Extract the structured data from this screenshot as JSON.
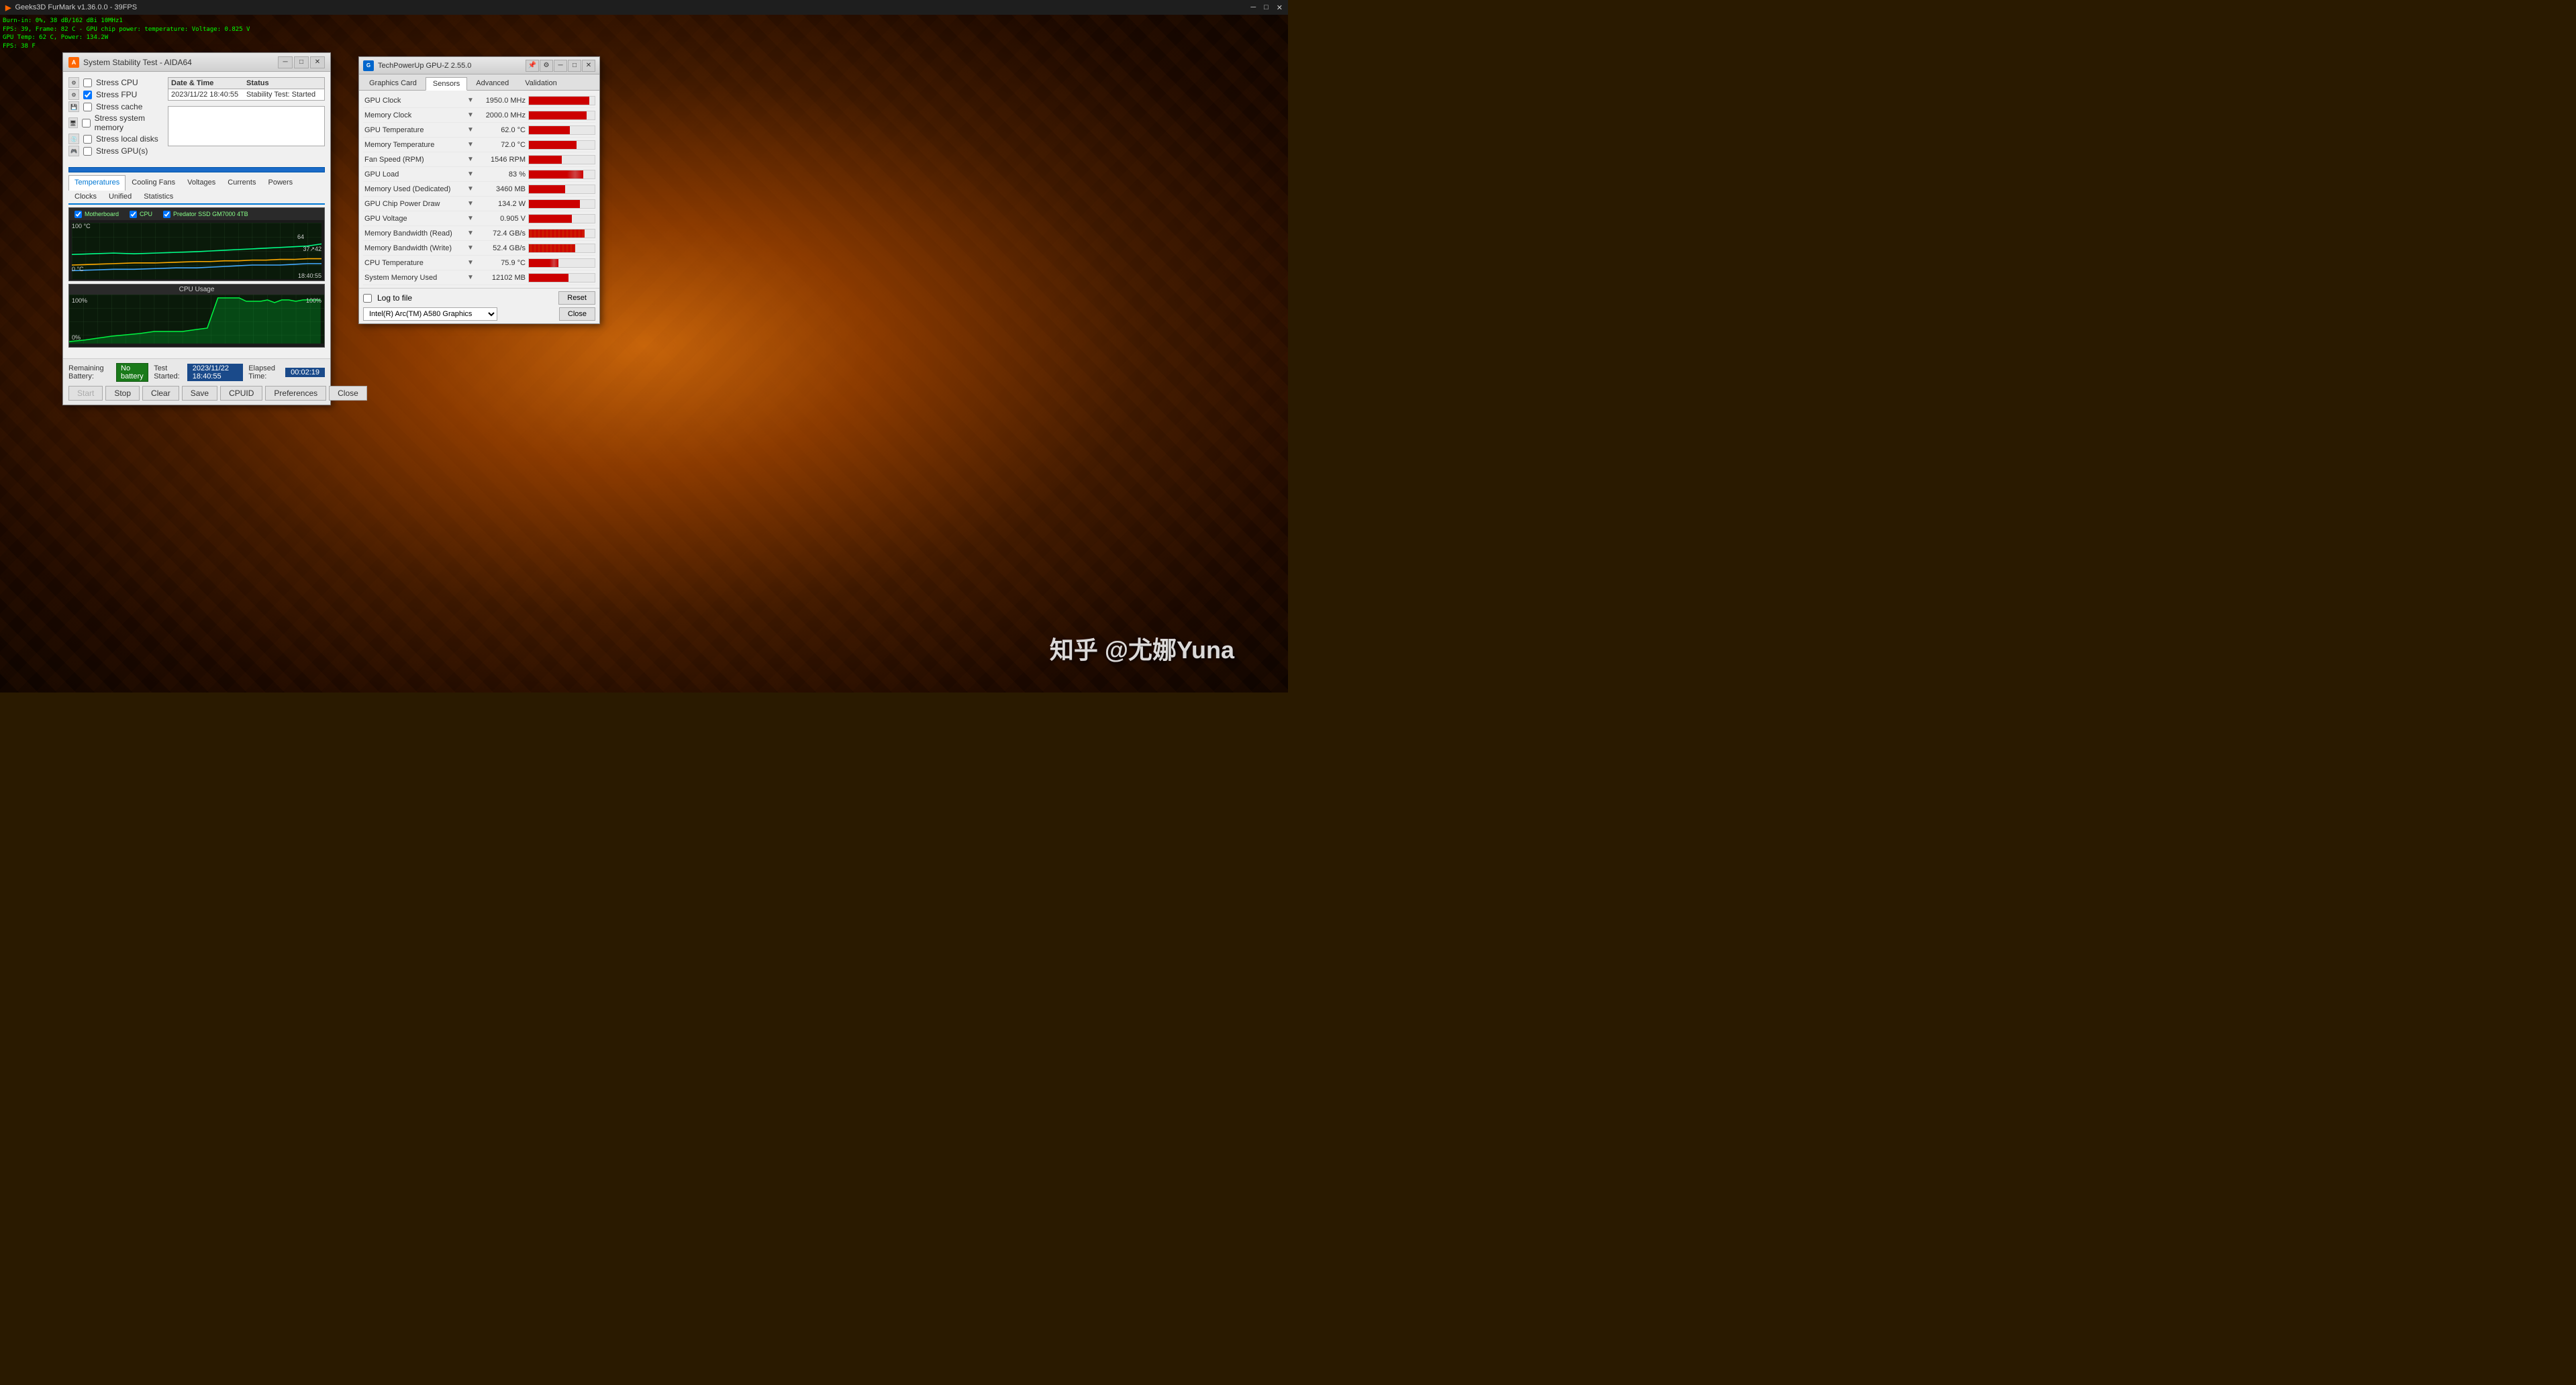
{
  "desktop": {
    "watermark": "知乎 @尤娜Yuna"
  },
  "furmark": {
    "titlebar": "Geeks3D FurMark v1.36.0.0 - 39FPS",
    "overlay_lines": [
      "Burn-in: 0%, 38 dB/162 dBi 10MHz1",
      "FPS: 39, Frame: 82 C - GPU chip power: temperature: Voltage: 0.825 V",
      "GPU Temp: 62 C, Power: 134.2W",
      "FPS: 38 F"
    ]
  },
  "aida": {
    "title": "System Stability Test - AIDA64",
    "stress_options": [
      {
        "label": "Stress CPU",
        "checked": false
      },
      {
        "label": "Stress FPU",
        "checked": true
      },
      {
        "label": "Stress cache",
        "checked": false
      },
      {
        "label": "Stress system memory",
        "checked": false
      },
      {
        "label": "Stress local disks",
        "checked": false
      },
      {
        "label": "Stress GPU(s)",
        "checked": false
      }
    ],
    "status_headers": [
      "Date & Time",
      "Status"
    ],
    "status_row": [
      "2023/11/22 18:40:55",
      "Stability Test: Started"
    ],
    "tabs": [
      "Temperatures",
      "Cooling Fans",
      "Voltages",
      "Currents",
      "Powers",
      "Clocks",
      "Unified",
      "Statistics"
    ],
    "active_tab": "Temperatures",
    "temp_graph": {
      "title": "",
      "legend": [
        "Motherboard",
        "CPU",
        "Predator SSD GM7000 4TB"
      ],
      "y_max": "100 °C",
      "y_min": "0 °C",
      "timestamp": "18:40:55",
      "value1": "64",
      "value2": "37",
      "value3": "42"
    },
    "cpu_graph": {
      "title": "CPU Usage",
      "y_max_left": "100%",
      "y_min_left": "0%",
      "y_max_right": "100%"
    },
    "battery_label": "Remaining Battery:",
    "battery_value": "No battery",
    "test_started_label": "Test Started:",
    "test_started_value": "2023/11/22 18:40:55",
    "elapsed_label": "Elapsed Time:",
    "elapsed_value": "00:02:19",
    "buttons": [
      "Start",
      "Stop",
      "Clear",
      "Save",
      "CPUID",
      "Preferences",
      "Close"
    ]
  },
  "gpuz": {
    "title": "TechPowerUp GPU-Z 2.55.0",
    "tabs": [
      "Graphics Card",
      "Sensors",
      "Advanced",
      "Validation"
    ],
    "active_tab": "Sensors",
    "sensors": [
      {
        "name": "GPU Clock",
        "value": "1950.0 MHz",
        "bar_pct": 92
      },
      {
        "name": "Memory Clock",
        "value": "2000.0 MHz",
        "bar_pct": 88
      },
      {
        "name": "GPU Temperature",
        "value": "62.0 °C",
        "bar_pct": 62
      },
      {
        "name": "Memory Temperature",
        "value": "72.0 °C",
        "bar_pct": 72
      },
      {
        "name": "Fan Speed (RPM)",
        "value": "1546 RPM",
        "bar_pct": 50
      },
      {
        "name": "GPU Load",
        "value": "83 %",
        "bar_pct": 83
      },
      {
        "name": "Memory Used (Dedicated)",
        "value": "3460 MB",
        "bar_pct": 55
      },
      {
        "name": "GPU Chip Power Draw",
        "value": "134.2 W",
        "bar_pct": 78
      },
      {
        "name": "GPU Voltage",
        "value": "0.905 V",
        "bar_pct": 65
      },
      {
        "name": "Memory Bandwidth (Read)",
        "value": "72.4 GB/s",
        "bar_pct": 85,
        "wavy": true
      },
      {
        "name": "Memory Bandwidth (Write)",
        "value": "52.4 GB/s",
        "bar_pct": 70,
        "wavy": true
      },
      {
        "name": "CPU Temperature",
        "value": "75.9 °C",
        "bar_pct": 45
      },
      {
        "name": "System Memory Used",
        "value": "12102 MB",
        "bar_pct": 60
      }
    ],
    "log_to_file": false,
    "log_label": "Log to file",
    "reset_btn": "Reset",
    "close_btn": "Close",
    "gpu_select": "Intel(R) Arc(TM) A580 Graphics"
  }
}
